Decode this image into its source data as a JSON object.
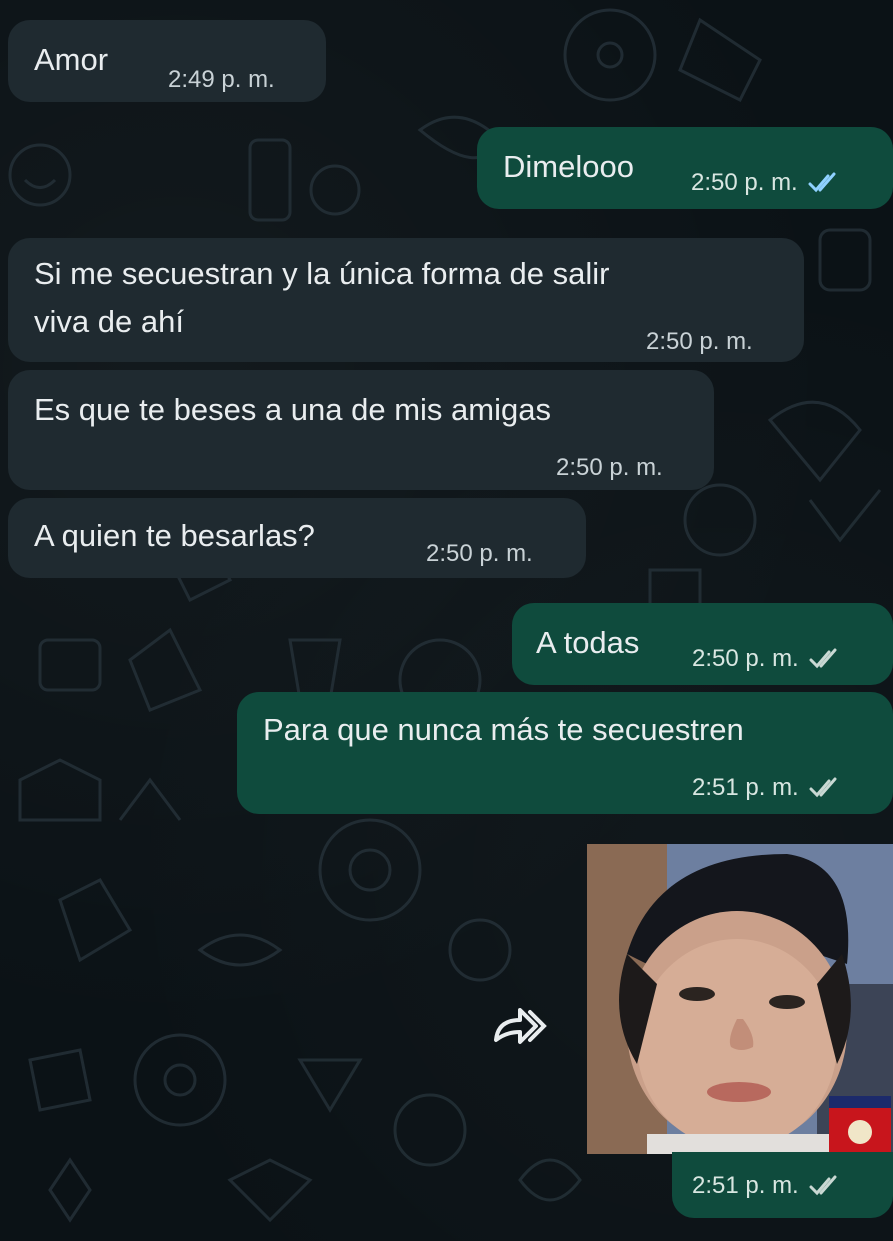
{
  "messages": [
    {
      "direction": "incoming",
      "text": "Amor",
      "time": "2:49 p. m."
    },
    {
      "direction": "outgoing",
      "text": "Dimelooo",
      "time": "2:50 p. m.",
      "status": "read"
    },
    {
      "direction": "incoming",
      "text_line1": "Si me secuestran y la única forma de salir",
      "text_line2": "viva de ahí",
      "time": "2:50 p. m."
    },
    {
      "direction": "incoming",
      "text": "Es que te beses a una de mis amigas",
      "time": "2:50 p. m."
    },
    {
      "direction": "incoming",
      "text": "A quien te besarlas?",
      "time": "2:50 p. m."
    },
    {
      "direction": "outgoing",
      "text": "A todas",
      "time": "2:50 p. m.",
      "status": "read"
    },
    {
      "direction": "outgoing",
      "text": "Para que nunca más te secuestren",
      "time": "2:51 p. m.",
      "status": "read"
    },
    {
      "direction": "outgoing",
      "type": "image",
      "image_description_icon": "photo",
      "time": "2:51 p. m.",
      "status": "read"
    }
  ],
  "colors": {
    "background": "#0b1216",
    "incoming_bubble": "#1f2a30",
    "outgoing_bubble": "#0f4b3d",
    "read_check_color": "#8fd1ff",
    "text": "#e9edef"
  },
  "icons": {
    "read_receipt": "double-check-icon",
    "forward": "forward-icon"
  }
}
